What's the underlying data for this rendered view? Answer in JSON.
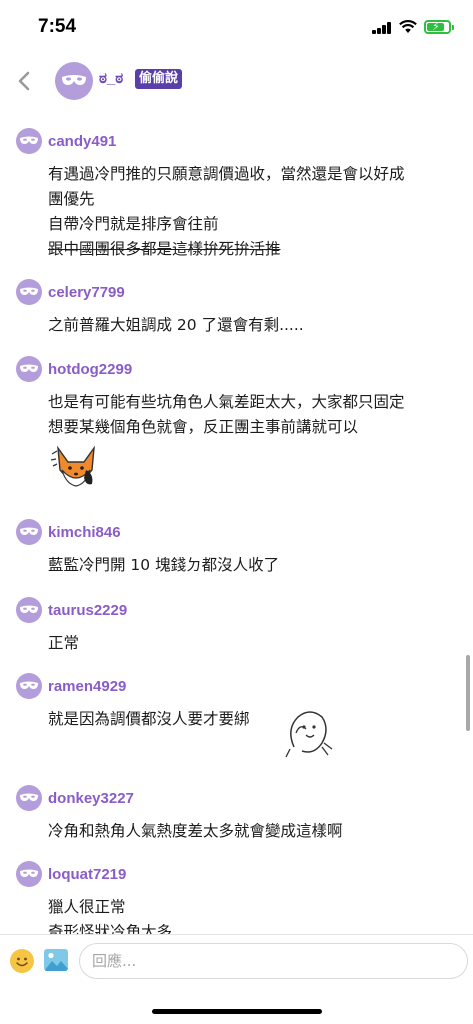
{
  "status_bar": {
    "time": "7:54",
    "battery_level": 0.75
  },
  "header": {
    "name": "ಠ_ಠ",
    "badge": "偷偷說"
  },
  "comments": [
    {
      "user": "candy491",
      "lines": [
        "有遇過冷門推的只願意調價過收，當然還是會以好成",
        "團優先",
        "自帶冷門就是排序會往前"
      ],
      "strike_line": "跟中國團很多都是這樣拚死拚活推"
    },
    {
      "user": "celery7799",
      "lines": [
        "之前普羅大姐調成 20 了還會有剩....."
      ]
    },
    {
      "user": "hotdog2299",
      "lines": [
        "也是有可能有些坑角色人氣差距太大，大家都只固定",
        "想要某幾個角色就會，反正團主事前講就可以"
      ]
    },
    {
      "user": "kimchi846",
      "lines": [
        "藍監冷門開 10 塊錢ㄉ都沒人收了"
      ]
    },
    {
      "user": "taurus2229",
      "lines": [
        "正常"
      ]
    },
    {
      "user": "ramen4929",
      "lines": [
        "就是因為調價都沒人要才要綁"
      ]
    },
    {
      "user": "donkey3227",
      "lines": [
        "冷角和熱角人氣熱度差太多就會變成這樣啊"
      ]
    },
    {
      "user": "loquat7219",
      "lines": [
        "獵人很正常",
        "奇形怪狀冷角太多"
      ]
    }
  ],
  "reply": {
    "placeholder": "回應..."
  },
  "icons": {
    "back": "chevron-left-icon",
    "avatar": "mask-icon",
    "emoji": "emoji-icon",
    "image": "image-icon"
  },
  "colors": {
    "accent": "#8a5cc8",
    "badge": "#5b3fa8",
    "avatar": "#b39ddb"
  }
}
